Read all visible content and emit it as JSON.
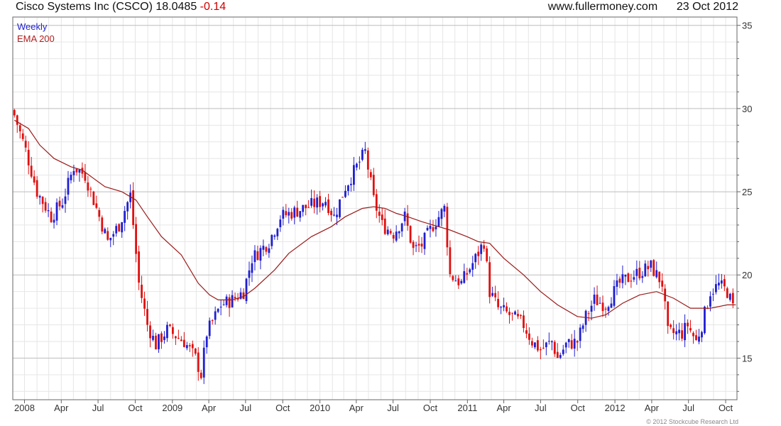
{
  "header": {
    "title": "Cisco Systems Inc (CSCO)",
    "last": "18.0485",
    "change": "-0.14",
    "site": "www.fullermoney.com",
    "date": "23 Oct 2012"
  },
  "legend": {
    "weekly": "Weekly",
    "ema": "EMA 200"
  },
  "footer": {
    "copyright": "© 2012 Stockcube Research Ltd"
  },
  "colors": {
    "up": "#1f1fd1",
    "down": "#e01010",
    "ema": "#9b1b1b",
    "grid": "#d9d9d9",
    "axis": "#666666"
  },
  "chart_data": {
    "type": "candlestick",
    "title": "Cisco Systems Inc (CSCO) 18.0485 -0.14",
    "ylim": [
      12.5,
      35.5
    ],
    "y_ticks": [
      15,
      20,
      25,
      30,
      35
    ],
    "x_range": [
      "2007-12-03",
      "2012-10-29"
    ],
    "x_ticks": [
      {
        "label": "2008",
        "date": "2008-01-01"
      },
      {
        "label": "Apr",
        "date": "2008-04-01"
      },
      {
        "label": "Jul",
        "date": "2008-07-01"
      },
      {
        "label": "Oct",
        "date": "2008-10-01"
      },
      {
        "label": "2009",
        "date": "2009-01-01"
      },
      {
        "label": "Apr",
        "date": "2009-04-01"
      },
      {
        "label": "Jul",
        "date": "2009-07-01"
      },
      {
        "label": "Oct",
        "date": "2009-10-01"
      },
      {
        "label": "2010",
        "date": "2010-01-01"
      },
      {
        "label": "Apr",
        "date": "2010-04-01"
      },
      {
        "label": "Jul",
        "date": "2010-07-01"
      },
      {
        "label": "Oct",
        "date": "2010-10-01"
      },
      {
        "label": "2011",
        "date": "2011-01-01"
      },
      {
        "label": "Apr",
        "date": "2011-04-01"
      },
      {
        "label": "Jul",
        "date": "2011-07-01"
      },
      {
        "label": "Oct",
        "date": "2011-10-01"
      },
      {
        "label": "2012",
        "date": "2012-01-01"
      },
      {
        "label": "Apr",
        "date": "2012-04-01"
      },
      {
        "label": "Jul",
        "date": "2012-07-01"
      },
      {
        "label": "Oct",
        "date": "2012-10-01"
      }
    ],
    "series": [
      {
        "name": "Weekly",
        "kind": "candlestick",
        "start_date": "2007-12-07",
        "interval_days": 7,
        "close_path": [
          [
            "2007-12-07",
            29.6
          ],
          [
            "2008-01-04",
            27.5
          ],
          [
            "2008-02-01",
            25.0
          ],
          [
            "2008-03-07",
            23.5
          ],
          [
            "2008-04-04",
            24.4
          ],
          [
            "2008-05-02",
            26.5
          ],
          [
            "2008-05-30",
            26.0
          ],
          [
            "2008-06-27",
            24.0
          ],
          [
            "2008-07-25",
            22.0
          ],
          [
            "2008-08-22",
            23.0
          ],
          [
            "2008-09-19",
            24.8
          ],
          [
            "2008-10-10",
            19.5
          ],
          [
            "2008-10-31",
            17.0
          ],
          [
            "2008-11-21",
            15.8
          ],
          [
            "2008-12-19",
            16.7
          ],
          [
            "2009-01-30",
            16.0
          ],
          [
            "2009-02-27",
            15.0
          ],
          [
            "2009-03-13",
            14.0
          ],
          [
            "2009-03-27",
            16.5
          ],
          [
            "2009-05-01",
            18.2
          ],
          [
            "2009-05-29",
            18.5
          ],
          [
            "2009-06-26",
            19.0
          ],
          [
            "2009-07-17",
            21.0
          ],
          [
            "2009-08-28",
            22.0
          ],
          [
            "2009-09-25",
            23.5
          ],
          [
            "2009-10-30",
            23.8
          ],
          [
            "2009-12-11",
            24.2
          ],
          [
            "2010-01-15",
            24.5
          ],
          [
            "2010-02-05",
            23.5
          ],
          [
            "2010-03-05",
            25.3
          ],
          [
            "2010-04-02",
            26.5
          ],
          [
            "2010-04-23",
            27.4
          ],
          [
            "2010-05-14",
            24.5
          ],
          [
            "2010-06-04",
            23.0
          ],
          [
            "2010-07-02",
            22.5
          ],
          [
            "2010-07-30",
            23.5
          ],
          [
            "2010-08-20",
            21.5
          ],
          [
            "2010-09-10",
            21.8
          ],
          [
            "2010-10-08",
            23.0
          ],
          [
            "2010-11-05",
            24.0
          ],
          [
            "2010-11-19",
            20.0
          ],
          [
            "2010-12-17",
            19.5
          ],
          [
            "2011-01-21",
            21.0
          ],
          [
            "2011-02-11",
            22.0
          ],
          [
            "2011-02-25",
            19.0
          ],
          [
            "2011-03-18",
            18.0
          ],
          [
            "2011-04-22",
            17.5
          ],
          [
            "2011-05-20",
            17.0
          ],
          [
            "2011-06-10",
            16.0
          ],
          [
            "2011-07-01",
            15.5
          ],
          [
            "2011-07-29",
            16.0
          ],
          [
            "2011-08-12",
            15.0
          ],
          [
            "2011-09-02",
            15.8
          ],
          [
            "2011-09-30",
            16.0
          ],
          [
            "2011-10-21",
            17.5
          ],
          [
            "2011-11-11",
            18.5
          ],
          [
            "2011-12-09",
            18.2
          ],
          [
            "2012-01-13",
            19.5
          ],
          [
            "2012-02-17",
            20.0
          ],
          [
            "2012-03-30",
            20.5
          ],
          [
            "2012-04-27",
            19.5
          ],
          [
            "2012-05-11",
            16.5
          ],
          [
            "2012-06-15",
            16.5
          ],
          [
            "2012-06-29",
            17.0
          ],
          [
            "2012-07-20",
            16.0
          ],
          [
            "2012-08-03",
            17.0
          ],
          [
            "2012-08-24",
            19.0
          ],
          [
            "2012-09-14",
            19.4
          ],
          [
            "2012-10-05",
            19.0
          ],
          [
            "2012-10-19",
            18.05
          ]
        ]
      },
      {
        "name": "EMA 200",
        "kind": "line",
        "points": [
          [
            "2007-12-07",
            29.3
          ],
          [
            "2008-01-11",
            28.8
          ],
          [
            "2008-02-08",
            27.8
          ],
          [
            "2008-03-14",
            27.0
          ],
          [
            "2008-04-25",
            26.5
          ],
          [
            "2008-05-23",
            26.3
          ],
          [
            "2008-06-20",
            25.8
          ],
          [
            "2008-07-18",
            25.3
          ],
          [
            "2008-08-29",
            25.0
          ],
          [
            "2008-10-03",
            24.5
          ],
          [
            "2008-10-31",
            23.5
          ],
          [
            "2008-12-05",
            22.3
          ],
          [
            "2009-01-23",
            21.2
          ],
          [
            "2009-03-06",
            19.5
          ],
          [
            "2009-04-03",
            18.8
          ],
          [
            "2009-04-24",
            18.5
          ],
          [
            "2009-05-29",
            18.5
          ],
          [
            "2009-06-26",
            18.7
          ],
          [
            "2009-07-24",
            19.2
          ],
          [
            "2009-09-11",
            20.3
          ],
          [
            "2009-10-16",
            21.3
          ],
          [
            "2009-12-11",
            22.3
          ],
          [
            "2010-01-29",
            22.9
          ],
          [
            "2010-03-05",
            23.5
          ],
          [
            "2010-04-16",
            24.0
          ],
          [
            "2010-05-14",
            24.1
          ],
          [
            "2010-06-11",
            24.0
          ],
          [
            "2010-07-09",
            23.7
          ],
          [
            "2010-08-06",
            23.5
          ],
          [
            "2010-09-10",
            23.2
          ],
          [
            "2010-10-08",
            23.0
          ],
          [
            "2010-11-19",
            22.7
          ],
          [
            "2010-12-31",
            22.3
          ],
          [
            "2011-01-28",
            22.0
          ],
          [
            "2011-02-25",
            21.9
          ],
          [
            "2011-04-01",
            21.0
          ],
          [
            "2011-05-20",
            20.0
          ],
          [
            "2011-07-01",
            19.0
          ],
          [
            "2011-08-12",
            18.2
          ],
          [
            "2011-09-30",
            17.5
          ],
          [
            "2011-11-04",
            17.4
          ],
          [
            "2011-12-09",
            17.6
          ],
          [
            "2012-01-20",
            18.3
          ],
          [
            "2012-03-02",
            18.8
          ],
          [
            "2012-04-13",
            19.0
          ],
          [
            "2012-05-25",
            18.6
          ],
          [
            "2012-07-06",
            18.0
          ],
          [
            "2012-08-24",
            18.0
          ],
          [
            "2012-10-05",
            18.2
          ],
          [
            "2012-10-26",
            18.2
          ]
        ]
      }
    ]
  }
}
